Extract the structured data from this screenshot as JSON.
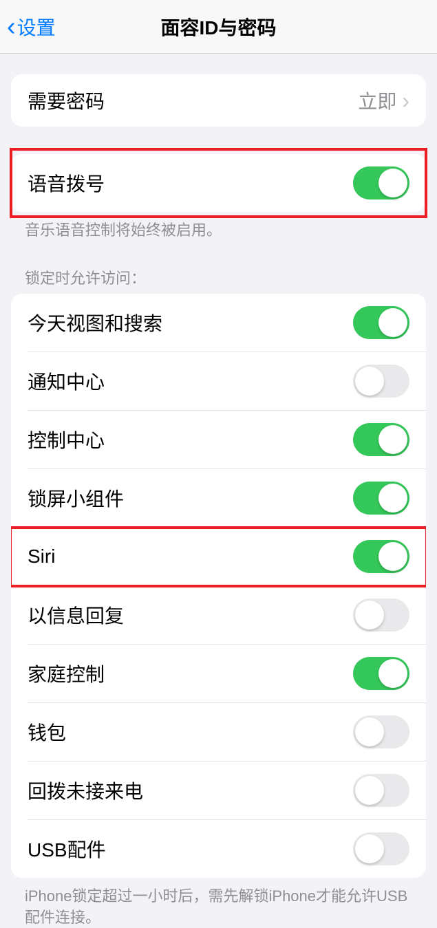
{
  "nav": {
    "back_label": "设置",
    "title": "面容ID与密码"
  },
  "passcode": {
    "require_label": "需要密码",
    "require_value": "立即"
  },
  "voice_dial": {
    "label": "语音拨号",
    "on": true,
    "footer": "音乐语音控制将始终被启用。"
  },
  "lock_access": {
    "header": "锁定时允许访问：",
    "items": [
      {
        "label": "今天视图和搜索",
        "on": true,
        "highlighted": false
      },
      {
        "label": "通知中心",
        "on": false,
        "highlighted": false
      },
      {
        "label": "控制中心",
        "on": true,
        "highlighted": false
      },
      {
        "label": "锁屏小组件",
        "on": true,
        "highlighted": false
      },
      {
        "label": "Siri",
        "on": true,
        "highlighted": true
      },
      {
        "label": "以信息回复",
        "on": false,
        "highlighted": false
      },
      {
        "label": "家庭控制",
        "on": true,
        "highlighted": false
      },
      {
        "label": "钱包",
        "on": false,
        "highlighted": false
      },
      {
        "label": "回拨未接来电",
        "on": false,
        "highlighted": false
      },
      {
        "label": "USB配件",
        "on": false,
        "highlighted": false
      }
    ],
    "footer": "iPhone锁定超过一小时后，需先解锁iPhone才能允许USB配件连接。"
  }
}
